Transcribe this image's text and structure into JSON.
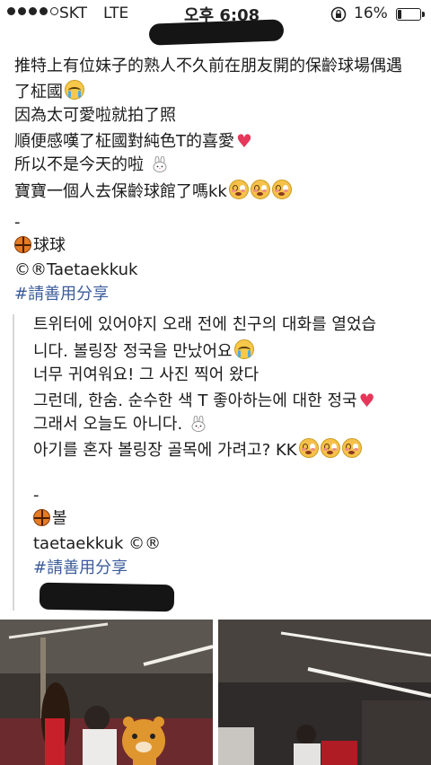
{
  "status_bar": {
    "carrier": "SKT",
    "network": "LTE",
    "time": "오후 6:08",
    "battery_percent": "16%",
    "battery_level": 0.16,
    "signal_bars_filled": 4
  },
  "post": {
    "lines": [
      "推特上有位妹子的熟人不久前在朋友開的保齡球場偶遇",
      "了柾國",
      "因為太可愛啦就拍了照",
      "順便感嘆了柾國對純色T的喜愛",
      "所以不是今天的啦",
      "寶寶一個人去保齡球館了嗎kk"
    ],
    "dash": "-",
    "source_label": "球球",
    "copyright": "©®Taetaekkuk",
    "hashtag": "#請善用分享"
  },
  "quote": {
    "lines": [
      "트위터에 있어야지 오래 전에 친구의 대화를 열었습",
      "니다. 볼링장 정국을 만났어요",
      "너무 귀여워요! 그 사진 찍어 왔다",
      "그런데, 한숨. 순수한 색 T 좋아하는에 대한 정국",
      "그래서 오늘도 아니다.",
      "아기를 혼자 볼링장 골목에 가려고? KK"
    ],
    "dash": "-",
    "source_label": "볼",
    "copyright": "taetaekkuk ©®",
    "hashtag": "#請善用分享"
  },
  "icons": {
    "crying_face": "loudly-crying-face-icon",
    "heart": "red-heart-icon",
    "rabbit": "rabbit-face-icon",
    "flushed_face": "flushed-face-icon",
    "basketball": "basketball-icon",
    "lock": "rotation-lock-icon"
  },
  "colors": {
    "hashtag": "#3b5b9b",
    "heart": "#e5375a",
    "quote_bar": "#d7d7d7"
  }
}
